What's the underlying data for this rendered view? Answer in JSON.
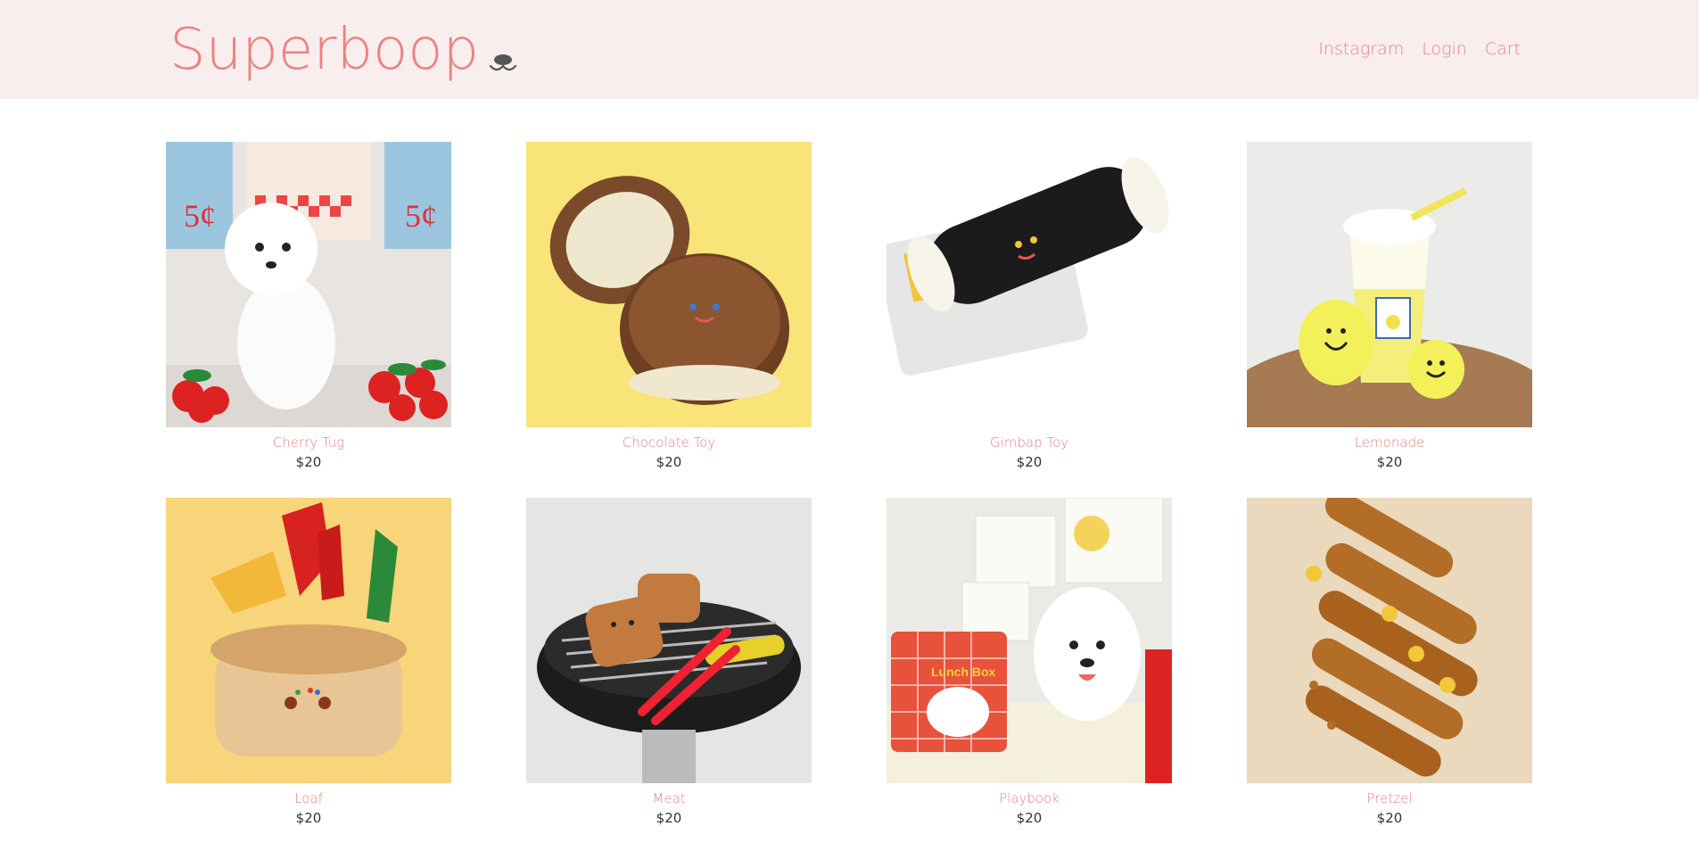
{
  "header": {
    "logo_text": "Superboop",
    "nav": [
      {
        "label": "Instagram"
      },
      {
        "label": "Login"
      },
      {
        "label": "Cart"
      }
    ]
  },
  "products": [
    {
      "name": "Cherry Tug",
      "price": "$20",
      "image": "white bichon dog with red cherry plush toys"
    },
    {
      "name": "Chocolate Toy",
      "price": "$20",
      "image": "brown plush sandwich cookie toy on yellow"
    },
    {
      "name": "Gimbap Toy",
      "price": "$20",
      "image": "black plush gimbap roll toy with package"
    },
    {
      "name": "Lemonade",
      "price": "$20",
      "image": "yellow lemonade cup plush toy with lemons"
    },
    {
      "name": "Loaf",
      "price": "$20",
      "image": "bread loaf plush toy with cheese and pepper pieces"
    },
    {
      "name": "Meat",
      "price": "$20",
      "image": "barbecue grill plush toy set with meat"
    },
    {
      "name": "Playbook",
      "price": "$20",
      "image": "white dog with lunch box book plush toy"
    },
    {
      "name": "Pretzel",
      "price": "$20",
      "image": "brown pretzel plush toys on beige"
    }
  ],
  "colors": {
    "header_bg": "#f9eeee",
    "accent": "#f08080",
    "price": "#333333"
  }
}
